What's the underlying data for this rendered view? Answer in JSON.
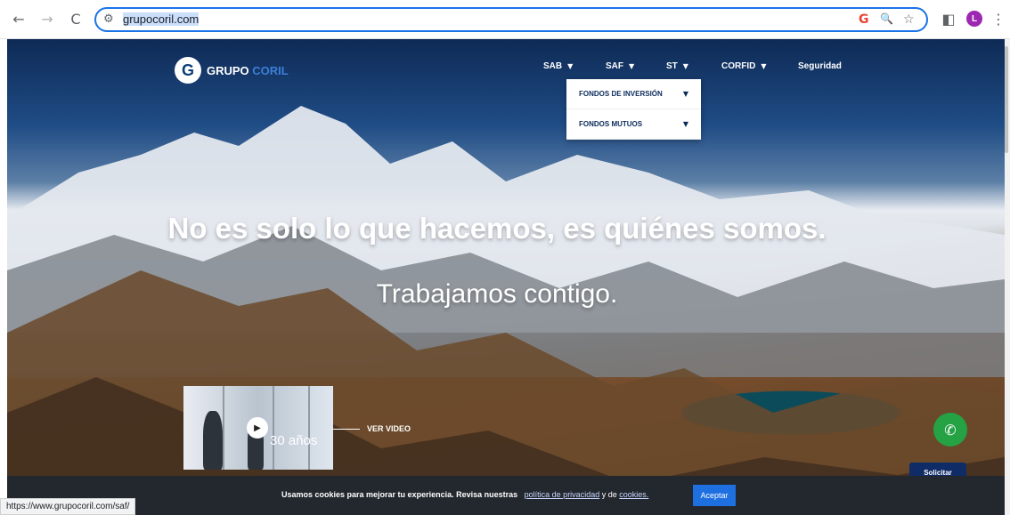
{
  "browser": {
    "back_icon": "←",
    "forward_icon": "→",
    "reload_icon": "C",
    "site_info_icon": "⚙",
    "url": "grupocoril.com",
    "google_icon": "G",
    "zoom_icon": "🔍",
    "star_icon": "☆",
    "sidepanel_icon": "◧",
    "profile_initial": "L",
    "menu_icon": "⋮"
  },
  "logo": {
    "mark": "G",
    "word1": "GRUPO",
    "word2": "CORIL"
  },
  "nav": {
    "items": [
      {
        "label": "SAB"
      },
      {
        "label": "SAF"
      },
      {
        "label": "ST"
      },
      {
        "label": "CORFID"
      },
      {
        "label": "Seguridad"
      }
    ],
    "caret": "▼"
  },
  "dropdown": {
    "items": [
      {
        "label": "FONDOS DE INVERSIÓN"
      },
      {
        "label": "FONDOS MUTUOS"
      }
    ]
  },
  "hero": {
    "line1": "No es solo lo que hacemos, es quiénes somos.",
    "line2": "Trabajamos contigo."
  },
  "video": {
    "play_icon": "▶",
    "caption": "30 años",
    "link": "VER VIDEO"
  },
  "whatsapp_icon": "✆",
  "solicitar": "Solicitar",
  "cookie": {
    "text": "Usamos cookies para mejorar tu experiencia. Revisa nuestras",
    "privacy_link": "política de privacidad",
    "and": "y de",
    "cookies_link": "cookies.",
    "accept": "Aceptar"
  },
  "status_url": "https://www.grupocoril.com/saf/"
}
